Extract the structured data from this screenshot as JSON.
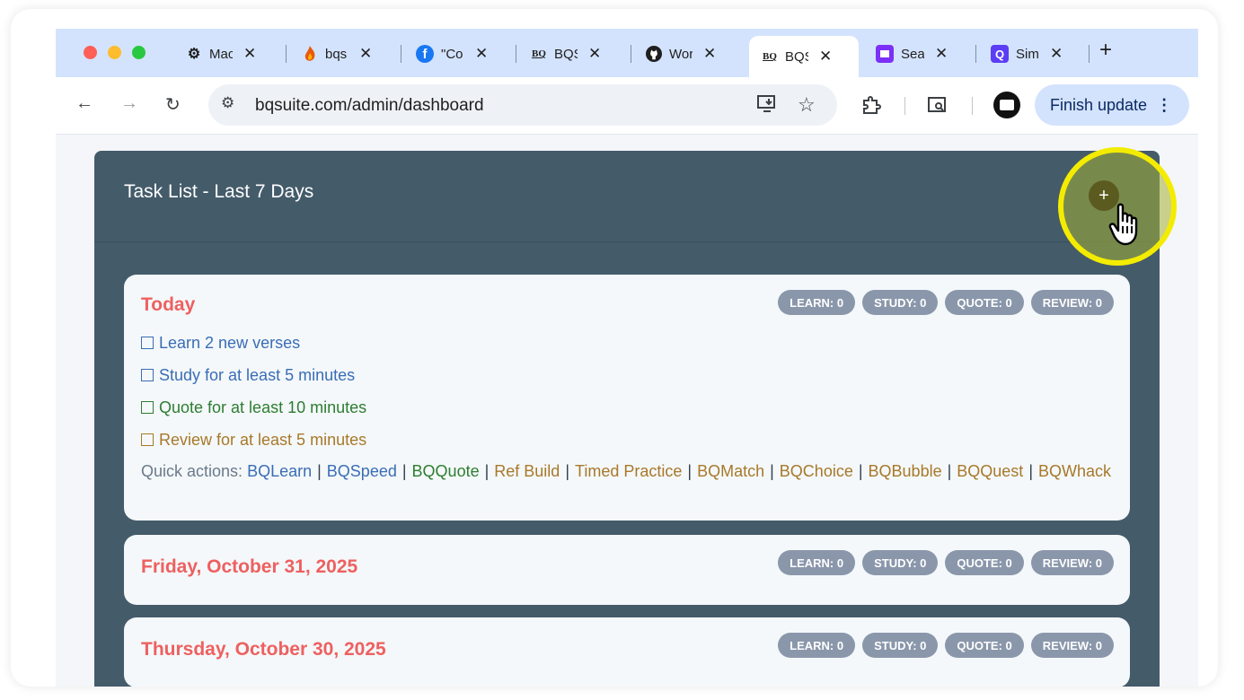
{
  "browser": {
    "tabs": [
      {
        "icon": "openai-icon",
        "glyph": "⚙",
        "title": "Mac",
        "color": "#1f1f1f"
      },
      {
        "icon": "flame-icon",
        "glyph": "🔥",
        "title": "bqs",
        "color": "#e8590c"
      },
      {
        "icon": "facebook-icon",
        "glyph": "f",
        "title": "\"Co",
        "color": "#1877f2"
      },
      {
        "icon": "bq-icon",
        "glyph": "BQ",
        "title": "BQS",
        "color": "#1f1f1f"
      },
      {
        "icon": "github-icon",
        "glyph": "●",
        "title": "Wor",
        "color": "#1f1f1f"
      },
      {
        "icon": "bq-icon",
        "glyph": "BQ",
        "title": "BQS",
        "color": "#1f1f1f",
        "active": true
      },
      {
        "icon": "search-app-icon",
        "glyph": "■",
        "title": "Sea",
        "color": "#7b2ff7"
      },
      {
        "icon": "sim-icon",
        "glyph": "Q",
        "title": "Sim",
        "color": "#5b3df5"
      }
    ],
    "url": "bqsuite.com/admin/dashboard",
    "update_label": "Finish update"
  },
  "panel": {
    "title": "Task List - Last 7 Days",
    "add_label": "+"
  },
  "days": [
    {
      "date": "Today",
      "badges": [
        "LEARN: 0",
        "STUDY: 0",
        "QUOTE: 0",
        "REVIEW: 0"
      ],
      "tasks": [
        {
          "label": "Learn 2 new verses",
          "color": "#3a6db5"
        },
        {
          "label": "Study for at least 5 minutes",
          "color": "#3a6db5"
        },
        {
          "label": "Quote for at least 10 minutes",
          "color": "#2e7d32"
        },
        {
          "label": "Review for at least 5 minutes",
          "color": "#a8782a"
        }
      ],
      "quick_label": "Quick actions:",
      "quick_actions": [
        {
          "label": "BQLearn",
          "color": "#3a6db5"
        },
        {
          "label": "BQSpeed",
          "color": "#3a6db5"
        },
        {
          "label": "BQQuote",
          "color": "#2e7d32"
        },
        {
          "label": "Ref Build",
          "color": "#a8782a"
        },
        {
          "label": "Timed Practice",
          "color": "#a8782a"
        },
        {
          "label": "BQMatch",
          "color": "#a8782a"
        },
        {
          "label": "BQChoice",
          "color": "#a8782a"
        },
        {
          "label": "BQBubble",
          "color": "#a8782a"
        },
        {
          "label": "BQQuest",
          "color": "#a8782a"
        },
        {
          "label": "BQWhack",
          "color": "#a8782a"
        }
      ]
    },
    {
      "date": "Friday, October 31, 2025",
      "badges": [
        "LEARN: 0",
        "STUDY: 0",
        "QUOTE: 0",
        "REVIEW: 0"
      ]
    },
    {
      "date": "Thursday, October 30, 2025",
      "badges": [
        "LEARN: 0",
        "STUDY: 0",
        "QUOTE: 0",
        "REVIEW: 0"
      ]
    }
  ]
}
